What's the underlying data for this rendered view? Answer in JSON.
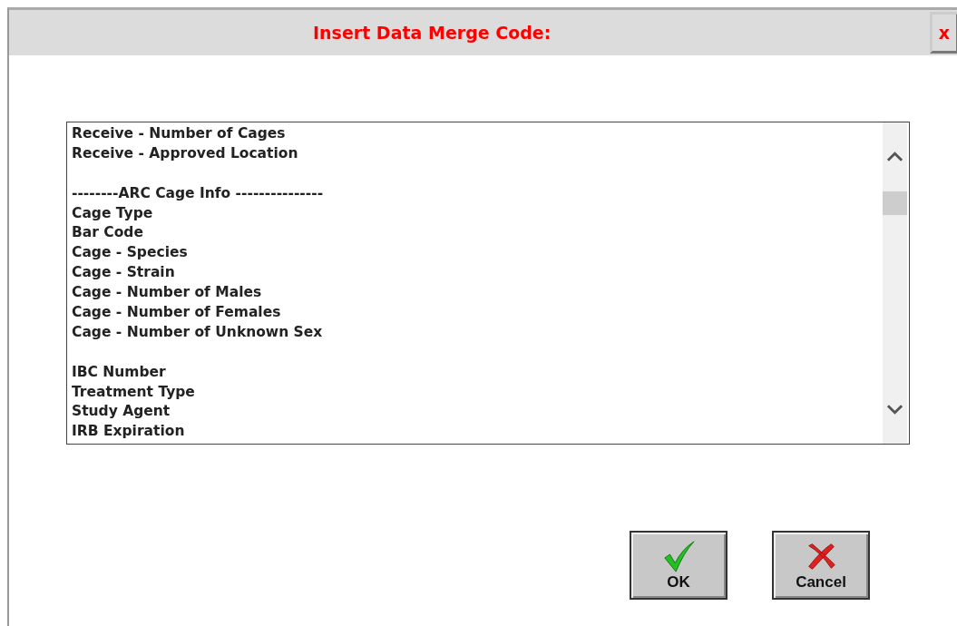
{
  "window": {
    "title": "Insert Data Merge Code:",
    "close": "x"
  },
  "list": {
    "items": [
      {
        "kind": "item",
        "text": "Receive - Number of Cages"
      },
      {
        "kind": "item",
        "text": "Receive - Approved Location"
      },
      {
        "kind": "spacer"
      },
      {
        "kind": "item",
        "text": "--------ARC Cage Info ---------------"
      },
      {
        "kind": "item",
        "text": "Cage Type"
      },
      {
        "kind": "item",
        "text": "Bar Code"
      },
      {
        "kind": "item",
        "text": "Cage - Species"
      },
      {
        "kind": "item",
        "text": "Cage - Strain"
      },
      {
        "kind": "item",
        "text": "Cage - Number of Males"
      },
      {
        "kind": "item",
        "text": "Cage - Number of Females"
      },
      {
        "kind": "item",
        "text": "Cage - Number of Unknown Sex"
      },
      {
        "kind": "spacer"
      },
      {
        "kind": "item",
        "text": "IBC Number"
      },
      {
        "kind": "item",
        "text": "Treatment Type"
      },
      {
        "kind": "item",
        "text": "Study Agent"
      },
      {
        "kind": "item",
        "text": "IRB Expiration"
      }
    ]
  },
  "buttons": [
    {
      "kind": "ok",
      "label": "OK"
    },
    {
      "kind": "cancel",
      "label": "Cancel"
    }
  ]
}
